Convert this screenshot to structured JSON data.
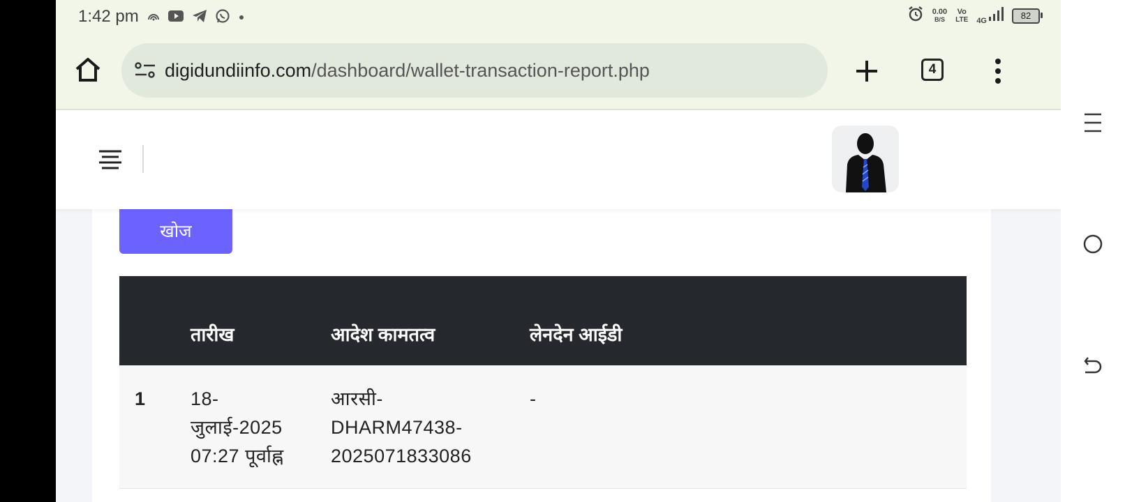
{
  "status_bar": {
    "time": "1:42 pm",
    "net_speed_value": "0.00",
    "net_speed_unit": "B/S",
    "volte_top": "Vo",
    "volte_bottom": "LTE",
    "network_type": "4G",
    "battery": "82"
  },
  "browser": {
    "url_domain": "digidundiinfo.com",
    "url_path": "/dashboard/wallet-transaction-report.php",
    "tab_count": "4"
  },
  "search_button_label": "खोज",
  "table": {
    "headers": [
      "तारीख",
      "आदेश कामतत्व",
      "लेनदेन आईडी"
    ],
    "rows": [
      {
        "index": "1",
        "date_line1": "18-",
        "date_line2": "जुलाई-2025",
        "date_line3": "07:27 पूर्वाह्न",
        "order_line1": "आरसी-",
        "order_line2": "DHARM47438-",
        "order_line3": "2025071833086",
        "transaction_id": "-"
      }
    ]
  },
  "icons": {
    "header_menu": "hamburger-icon",
    "avatar": "user-avatar",
    "nav": [
      "recent-apps-icon",
      "home-circle-icon",
      "back-icon"
    ]
  },
  "colors": {
    "accent": "#6c63ff",
    "table_header_bg": "#25282c",
    "browser_bar_bg": "#f1f6e9"
  }
}
